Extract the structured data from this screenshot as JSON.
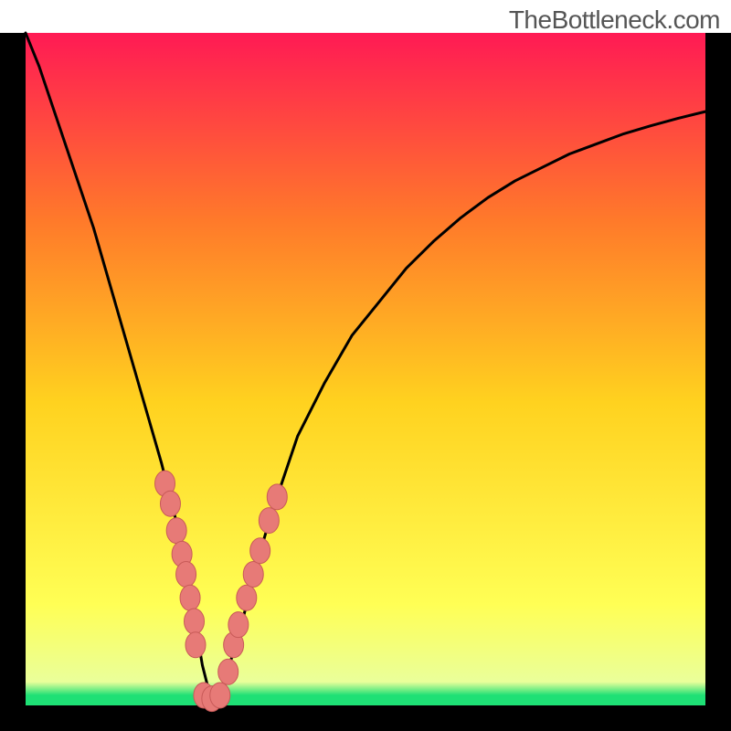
{
  "watermark": "TheBottleneck.com",
  "chart_data": {
    "type": "line",
    "title": "",
    "xlabel": "",
    "ylabel": "",
    "xlim": [
      0,
      100
    ],
    "ylim": [
      0,
      100
    ],
    "x": [
      0,
      2,
      4,
      6,
      8,
      10,
      12,
      14,
      16,
      18,
      20,
      22,
      24,
      25,
      26,
      27,
      28,
      29,
      30,
      32,
      34,
      36,
      38,
      40,
      44,
      48,
      52,
      56,
      60,
      64,
      68,
      72,
      76,
      80,
      84,
      88,
      92,
      96,
      100
    ],
    "values": [
      100,
      95,
      89,
      83,
      77,
      71,
      64,
      57,
      50,
      43,
      36,
      28,
      19,
      12,
      6,
      2,
      0,
      2,
      6,
      13,
      21,
      28,
      34,
      40,
      48,
      55,
      60,
      65,
      69,
      72.5,
      75.5,
      78,
      80,
      82,
      83.5,
      85,
      86.2,
      87.3,
      88.3
    ],
    "markers": [
      {
        "x": 20.5,
        "y": 33
      },
      {
        "x": 21.3,
        "y": 30
      },
      {
        "x": 22.2,
        "y": 26
      },
      {
        "x": 23.0,
        "y": 22.5
      },
      {
        "x": 23.6,
        "y": 19.5
      },
      {
        "x": 24.2,
        "y": 16
      },
      {
        "x": 24.8,
        "y": 12.5
      },
      {
        "x": 25.0,
        "y": 9
      },
      {
        "x": 26.2,
        "y": 1.5
      },
      {
        "x": 27.4,
        "y": 1
      },
      {
        "x": 28.6,
        "y": 1.5
      },
      {
        "x": 29.8,
        "y": 5
      },
      {
        "x": 30.6,
        "y": 9
      },
      {
        "x": 31.3,
        "y": 12
      },
      {
        "x": 32.5,
        "y": 16
      },
      {
        "x": 33.5,
        "y": 19.5
      },
      {
        "x": 34.5,
        "y": 23
      },
      {
        "x": 35.8,
        "y": 27.5
      },
      {
        "x": 37.0,
        "y": 31
      }
    ],
    "background_gradient": {
      "top": "#ff1a54",
      "upper_mid": "#ff7a2a",
      "mid": "#ffd21f",
      "lower_mid": "#ffff55",
      "bottom": "#1ee075"
    },
    "frame_color": "#000000",
    "curve_color": "#000000",
    "marker_fill": "#e77a77",
    "marker_stroke": "#c85a58"
  }
}
